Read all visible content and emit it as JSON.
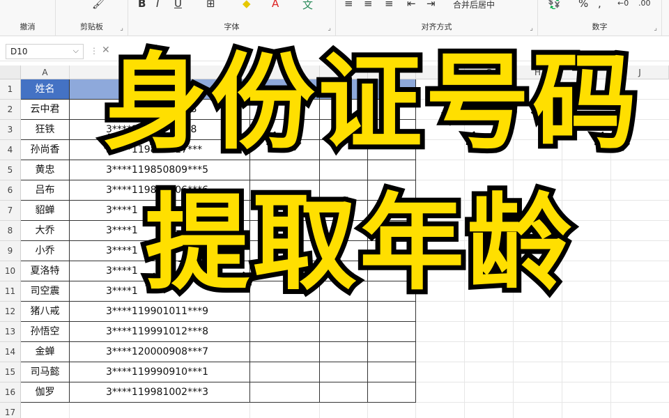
{
  "ribbon": {
    "groups": [
      {
        "label": "撤消"
      },
      {
        "label": "剪贴板"
      },
      {
        "label": "字体"
      },
      {
        "label": "对齐方式"
      },
      {
        "label": "数字"
      }
    ],
    "merge_button": "合并后居中"
  },
  "formula_bar": {
    "name_box": "D10"
  },
  "columns": [
    "A",
    "B",
    "C",
    "D",
    "E",
    "F",
    "G",
    "H",
    "I",
    "J"
  ],
  "rows": [
    "1",
    "2",
    "3",
    "4",
    "5",
    "6",
    "7",
    "8",
    "9",
    "10",
    "11",
    "12",
    "13",
    "14",
    "15",
    "16",
    "17"
  ],
  "table": {
    "header": "姓名",
    "records": [
      {
        "name": "云中君",
        "id": "3****1198*******8"
      },
      {
        "name": "狂铁",
        "id": "3****1198*******8"
      },
      {
        "name": "孙尚香",
        "id": "3****119850817***"
      },
      {
        "name": "黄忠",
        "id": "3****119850809***5"
      },
      {
        "name": "吕布",
        "id": "3****119850806***6"
      },
      {
        "name": "貂蝉",
        "id": "3****1"
      },
      {
        "name": "大乔",
        "id": "3****1"
      },
      {
        "name": "小乔",
        "id": "3****1"
      },
      {
        "name": "夏洛特",
        "id": "3****1"
      },
      {
        "name": "司空震",
        "id": "3****1"
      },
      {
        "name": "猪八戒",
        "id": "3****119901011***9"
      },
      {
        "name": "孙悟空",
        "id": "3****119991012***8"
      },
      {
        "name": "金蝉",
        "id": "3****120000908***7"
      },
      {
        "name": "司马懿",
        "id": "3****119990910***1"
      },
      {
        "name": "伽罗",
        "id": "3****119981002***3"
      }
    ]
  },
  "overlay": {
    "line1": "身份证号码",
    "line2": "提取年龄",
    "color": "#ffdf00"
  }
}
